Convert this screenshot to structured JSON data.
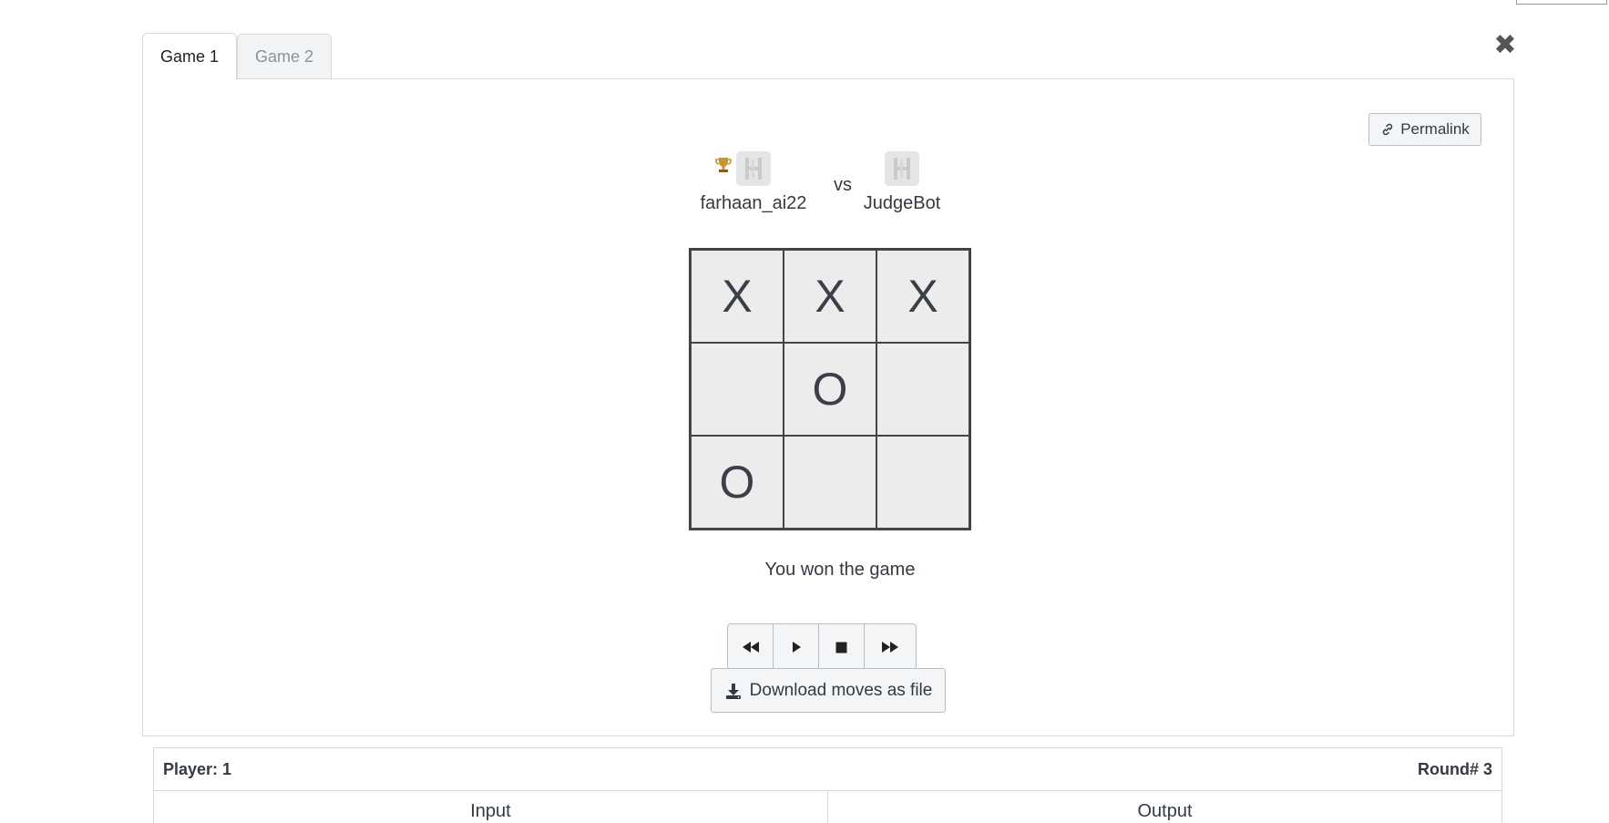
{
  "tabs": [
    {
      "label": "Game 1",
      "active": true
    },
    {
      "label": "Game 2",
      "active": false
    }
  ],
  "icons": {
    "close": "close-icon",
    "link": "link-icon",
    "trophy": "trophy-icon",
    "avatar": "avatar-icon",
    "rewind": "rewind-icon",
    "play": "play-icon",
    "stop": "stop-icon",
    "fast_forward": "fast-forward-icon",
    "download": "download-icon"
  },
  "permalink_label": "Permalink",
  "players": {
    "left": {
      "name": "farhaan_ai22",
      "winner": true
    },
    "vs": "vs",
    "right": {
      "name": "JudgeBot",
      "winner": false
    }
  },
  "board": {
    "cells": [
      "X",
      "X",
      "X",
      "",
      "O",
      "",
      "O",
      "",
      ""
    ]
  },
  "result_text": "You won the game",
  "download_label": "Download moves as file",
  "info": {
    "player_label": "Player: 1",
    "round_label": "Round# 3",
    "input_header": "Input",
    "output_header": "Output"
  },
  "colors": {
    "cell_bg": "#ececec",
    "text": "#333a44",
    "trophy": "#c8962e"
  }
}
